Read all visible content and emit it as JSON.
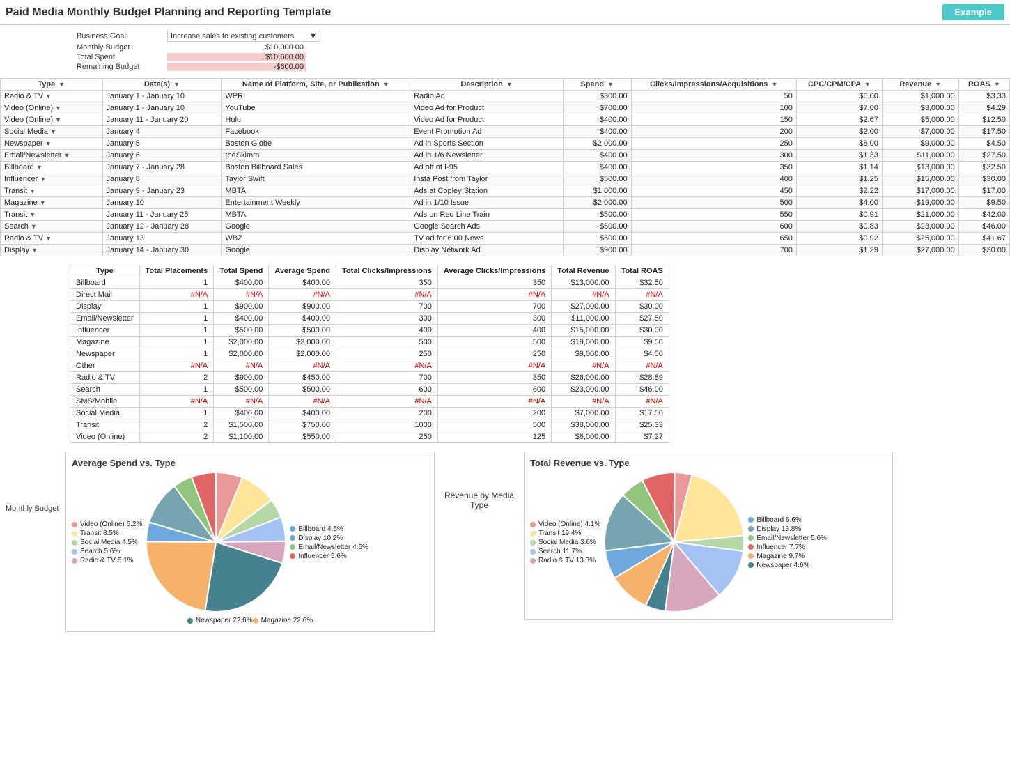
{
  "header": {
    "title": "Paid Media Monthly Budget Planning and Reporting Template",
    "badge": "Example"
  },
  "summary": {
    "business_goal_label": "Business Goal",
    "business_goal_value": "Increase sales to existing customers",
    "monthly_budget_label": "Monthly Budget",
    "monthly_budget_value": "$10,000.00",
    "total_spent_label": "Total Spent",
    "total_spent_value": "$10,600.00",
    "remaining_budget_label": "Remaining Budget",
    "remaining_budget_value": "-$600.00"
  },
  "main_table": {
    "headers": [
      "Type",
      "Date(s)",
      "Name of Platform, Site, or Publication",
      "Description",
      "Spend",
      "Clicks/Impressions/Acquisitions",
      "CPC/CPM/CPA",
      "Revenue",
      "ROAS"
    ],
    "rows": [
      [
        "Radio & TV",
        "January 1 - January 10",
        "WPRI",
        "Radio Ad",
        "$300.00",
        "50",
        "$6.00",
        "$1,000.00",
        "$3.33"
      ],
      [
        "Video (Online)",
        "January 1 - January 10",
        "YouTube",
        "Video Ad for Product",
        "$700.00",
        "100",
        "$7.00",
        "$3,000.00",
        "$4.29"
      ],
      [
        "Video (Online)",
        "January 11 - January 20",
        "Hulu",
        "Video Ad for Product",
        "$400.00",
        "150",
        "$2.67",
        "$5,000.00",
        "$12.50"
      ],
      [
        "Social Media",
        "January 4",
        "Facebook",
        "Event Promotion Ad",
        "$400.00",
        "200",
        "$2.00",
        "$7,000.00",
        "$17.50"
      ],
      [
        "Newspaper",
        "January 5",
        "Boston Globe",
        "Ad in Sports Section",
        "$2,000.00",
        "250",
        "$8.00",
        "$9,000.00",
        "$4.50"
      ],
      [
        "Email/Newsletter",
        "January 6",
        "theSkimm",
        "Ad in 1/6 Newsletter",
        "$400.00",
        "300",
        "$1.33",
        "$11,000.00",
        "$27.50"
      ],
      [
        "Billboard",
        "January 7 - January 28",
        "Boston Billboard Sales",
        "Ad off of I-95",
        "$400.00",
        "350",
        "$1.14",
        "$13,000.00",
        "$32.50"
      ],
      [
        "Influencer",
        "January 8",
        "Taylor Swift",
        "Insta Post from Taylor",
        "$500.00",
        "400",
        "$1.25",
        "$15,000.00",
        "$30.00"
      ],
      [
        "Transit",
        "January 9 - January 23",
        "MBTA",
        "Ads at Copley Station",
        "$1,000.00",
        "450",
        "$2.22",
        "$17,000.00",
        "$17.00"
      ],
      [
        "Magazine",
        "January 10",
        "Entertainment Weekly",
        "Ad in 1/10 Issue",
        "$2,000.00",
        "500",
        "$4.00",
        "$19,000.00",
        "$9.50"
      ],
      [
        "Transit",
        "January 11 - January 25",
        "MBTA",
        "Ads on Red Line Train",
        "$500.00",
        "550",
        "$0.91",
        "$21,000.00",
        "$42.00"
      ],
      [
        "Search",
        "January 12 - January 28",
        "Google",
        "Google Search Ads",
        "$500.00",
        "600",
        "$0.83",
        "$23,000.00",
        "$46.00"
      ],
      [
        "Radio & TV",
        "January 13",
        "WBZ",
        "TV ad for 6:00 News",
        "$600.00",
        "650",
        "$0.92",
        "$25,000.00",
        "$41.67"
      ],
      [
        "Display",
        "January 14 - January 30",
        "Google",
        "Display Network Ad",
        "$900.00",
        "700",
        "$1.29",
        "$27,000.00",
        "$30.00"
      ]
    ]
  },
  "summary_table": {
    "headers": [
      "Type",
      "Total Placements",
      "Total Spend",
      "Average Spend",
      "Total Clicks/Impressions",
      "Average Clicks/Impressions",
      "Total Revenue",
      "Total ROAS"
    ],
    "rows": [
      [
        "Billboard",
        "1",
        "$400.00",
        "$400.00",
        "350",
        "350",
        "$13,000.00",
        "$32.50"
      ],
      [
        "Direct Mail",
        "#N/A",
        "#N/A",
        "#N/A",
        "#N/A",
        "#N/A",
        "#N/A",
        "#N/A"
      ],
      [
        "Display",
        "1",
        "$900.00",
        "$900.00",
        "700",
        "700",
        "$27,000.00",
        "$30.00"
      ],
      [
        "Email/Newsletter",
        "1",
        "$400.00",
        "$400.00",
        "300",
        "300",
        "$11,000.00",
        "$27.50"
      ],
      [
        "Influencer",
        "1",
        "$500.00",
        "$500.00",
        "400",
        "400",
        "$15,000.00",
        "$30.00"
      ],
      [
        "Magazine",
        "1",
        "$2,000.00",
        "$2,000.00",
        "500",
        "500",
        "$19,000.00",
        "$9.50"
      ],
      [
        "Newspaper",
        "1",
        "$2,000.00",
        "$2,000.00",
        "250",
        "250",
        "$9,000.00",
        "$4.50"
      ],
      [
        "Other",
        "#N/A",
        "#N/A",
        "#N/A",
        "#N/A",
        "#N/A",
        "#N/A",
        "#N/A"
      ],
      [
        "Radio & TV",
        "2",
        "$900.00",
        "$450.00",
        "700",
        "350",
        "$26,000.00",
        "$28.89"
      ],
      [
        "Search",
        "1",
        "$500.00",
        "$500.00",
        "600",
        "600",
        "$23,000.00",
        "$46.00"
      ],
      [
        "SMS/Mobile",
        "#N/A",
        "#N/A",
        "#N/A",
        "#N/A",
        "#N/A",
        "#N/A",
        "#N/A"
      ],
      [
        "Social Media",
        "1",
        "$400.00",
        "$400.00",
        "200",
        "200",
        "$7,000.00",
        "$17.50"
      ],
      [
        "Transit",
        "2",
        "$1,500.00",
        "$750.00",
        "1000",
        "500",
        "$38,000.00",
        "$25.33"
      ],
      [
        "Video (Online)",
        "2",
        "$1,100.00",
        "$550.00",
        "250",
        "125",
        "$8,000.00",
        "$7.27"
      ]
    ]
  },
  "charts": {
    "spend_chart": {
      "title": "Average Spend vs. Type",
      "legend_left": [
        {
          "label": "Video (Online)",
          "pct": "6.2%",
          "color": "#ea9999"
        },
        {
          "label": "Transit",
          "pct": "8.5%",
          "color": "#ffe599"
        },
        {
          "label": "Social Media",
          "pct": "4.5%",
          "color": "#b6d7a8"
        },
        {
          "label": "Search",
          "pct": "5.6%",
          "color": "#a4c2f4"
        },
        {
          "label": "Radio & TV",
          "pct": "5.1%",
          "color": "#d5a6bd"
        }
      ],
      "legend_right": [
        {
          "label": "Billboard",
          "pct": "4.5%",
          "color": "#6fa8dc"
        },
        {
          "label": "Display",
          "pct": "10.2%",
          "color": "#76a5af"
        },
        {
          "label": "Email/Newsletter",
          "pct": "4.5%",
          "color": "#93c47d"
        },
        {
          "label": "Influencer",
          "pct": "5.6%",
          "color": "#e06666"
        }
      ],
      "legend_bottom": [
        {
          "label": "Newspaper",
          "pct": "22.6%",
          "color": "#45818e"
        },
        {
          "label": "Magazine",
          "pct": "22.6%",
          "color": "#f6b26b"
        }
      ]
    },
    "revenue_chart": {
      "title": "Total Revenue vs. Type",
      "label": "Revenue by Media Type",
      "legend_left": [
        {
          "label": "Video (Online)",
          "pct": "4.1%",
          "color": "#ea9999"
        },
        {
          "label": "Transit",
          "pct": "19.4%",
          "color": "#ffe599"
        },
        {
          "label": "Social Media",
          "pct": "3.6%",
          "color": "#b6d7a8"
        },
        {
          "label": "Search",
          "pct": "11.7%",
          "color": "#a4c2f4"
        },
        {
          "label": "Radio & TV",
          "pct": "13.3%",
          "color": "#d5a6bd"
        }
      ],
      "legend_right": [
        {
          "label": "Billboard",
          "pct": "6.6%",
          "color": "#6fa8dc"
        },
        {
          "label": "Display",
          "pct": "13.8%",
          "color": "#76a5af"
        },
        {
          "label": "Email/Newsletter",
          "pct": "5.6%",
          "color": "#93c47d"
        },
        {
          "label": "Influencer",
          "pct": "7.7%",
          "color": "#e06666"
        },
        {
          "label": "Magazine",
          "pct": "9.7%",
          "color": "#f6b26b"
        },
        {
          "label": "Newspaper",
          "pct": "4.6%",
          "color": "#45818e"
        }
      ]
    }
  },
  "monthly_budget_label": "Monthly Budget"
}
